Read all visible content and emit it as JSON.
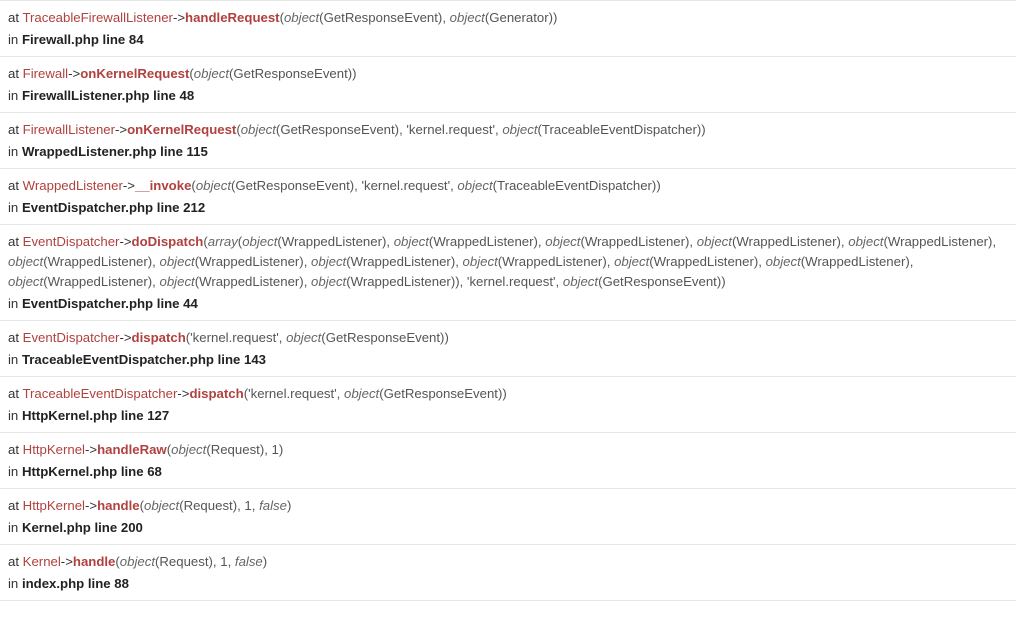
{
  "labels": {
    "at": "at",
    "in": "in",
    "arrow": "->"
  },
  "frames": [
    {
      "class": "TraceableFirewallListener",
      "function": "handleRequest",
      "args": [
        {
          "t": "p",
          "v": "("
        },
        {
          "t": "k",
          "v": "object"
        },
        {
          "t": "p",
          "v": "(GetResponseEvent), "
        },
        {
          "t": "k",
          "v": "object"
        },
        {
          "t": "p",
          "v": "(Generator))"
        }
      ],
      "location": "Firewall.php line 84"
    },
    {
      "class": "Firewall",
      "function": "onKernelRequest",
      "args": [
        {
          "t": "p",
          "v": "("
        },
        {
          "t": "k",
          "v": "object"
        },
        {
          "t": "p",
          "v": "(GetResponseEvent))"
        }
      ],
      "location": "FirewallListener.php line 48"
    },
    {
      "class": "FirewallListener",
      "function": "onKernelRequest",
      "args": [
        {
          "t": "p",
          "v": "("
        },
        {
          "t": "k",
          "v": "object"
        },
        {
          "t": "p",
          "v": "(GetResponseEvent), 'kernel.request', "
        },
        {
          "t": "k",
          "v": "object"
        },
        {
          "t": "p",
          "v": "(TraceableEventDispatcher))"
        }
      ],
      "location": "WrappedListener.php line 115"
    },
    {
      "class": "WrappedListener",
      "function": "__invoke",
      "args": [
        {
          "t": "p",
          "v": "("
        },
        {
          "t": "k",
          "v": "object"
        },
        {
          "t": "p",
          "v": "(GetResponseEvent), 'kernel.request', "
        },
        {
          "t": "k",
          "v": "object"
        },
        {
          "t": "p",
          "v": "(TraceableEventDispatcher))"
        }
      ],
      "location": "EventDispatcher.php line 212"
    },
    {
      "class": "EventDispatcher",
      "function": "doDispatch",
      "args": [
        {
          "t": "p",
          "v": "("
        },
        {
          "t": "k",
          "v": "array"
        },
        {
          "t": "p",
          "v": "("
        },
        {
          "t": "k",
          "v": "object"
        },
        {
          "t": "p",
          "v": "(WrappedListener), "
        },
        {
          "t": "k",
          "v": "object"
        },
        {
          "t": "p",
          "v": "(WrappedListener), "
        },
        {
          "t": "k",
          "v": "object"
        },
        {
          "t": "p",
          "v": "(WrappedListener), "
        },
        {
          "t": "k",
          "v": "object"
        },
        {
          "t": "p",
          "v": "(WrappedListener), "
        },
        {
          "t": "k",
          "v": "object"
        },
        {
          "t": "p",
          "v": "(WrappedListener), "
        },
        {
          "t": "k",
          "v": "object"
        },
        {
          "t": "p",
          "v": "(WrappedListener), "
        },
        {
          "t": "k",
          "v": "object"
        },
        {
          "t": "p",
          "v": "(WrappedListener), "
        },
        {
          "t": "k",
          "v": "object"
        },
        {
          "t": "p",
          "v": "(WrappedListener), "
        },
        {
          "t": "k",
          "v": "object"
        },
        {
          "t": "p",
          "v": "(WrappedListener), "
        },
        {
          "t": "k",
          "v": "object"
        },
        {
          "t": "p",
          "v": "(WrappedListener), "
        },
        {
          "t": "k",
          "v": "object"
        },
        {
          "t": "p",
          "v": "(WrappedListener), "
        },
        {
          "t": "k",
          "v": "object"
        },
        {
          "t": "p",
          "v": "(WrappedListener), "
        },
        {
          "t": "k",
          "v": "object"
        },
        {
          "t": "p",
          "v": "(WrappedListener), "
        },
        {
          "t": "k",
          "v": "object"
        },
        {
          "t": "p",
          "v": "(WrappedListener)), 'kernel.request', "
        },
        {
          "t": "k",
          "v": "object"
        },
        {
          "t": "p",
          "v": "(GetResponseEvent))"
        }
      ],
      "location": "EventDispatcher.php line 44"
    },
    {
      "class": "EventDispatcher",
      "function": "dispatch",
      "args": [
        {
          "t": "p",
          "v": "('kernel.request', "
        },
        {
          "t": "k",
          "v": "object"
        },
        {
          "t": "p",
          "v": "(GetResponseEvent))"
        }
      ],
      "location": "TraceableEventDispatcher.php line 143"
    },
    {
      "class": "TraceableEventDispatcher",
      "function": "dispatch",
      "args": [
        {
          "t": "p",
          "v": "('kernel.request', "
        },
        {
          "t": "k",
          "v": "object"
        },
        {
          "t": "p",
          "v": "(GetResponseEvent))"
        }
      ],
      "location": "HttpKernel.php line 127"
    },
    {
      "class": "HttpKernel",
      "function": "handleRaw",
      "args": [
        {
          "t": "p",
          "v": "("
        },
        {
          "t": "k",
          "v": "object"
        },
        {
          "t": "p",
          "v": "(Request), 1)"
        }
      ],
      "location": "HttpKernel.php line 68"
    },
    {
      "class": "HttpKernel",
      "function": "handle",
      "args": [
        {
          "t": "p",
          "v": "("
        },
        {
          "t": "k",
          "v": "object"
        },
        {
          "t": "p",
          "v": "(Request), 1, "
        },
        {
          "t": "k",
          "v": "false"
        },
        {
          "t": "p",
          "v": ")"
        }
      ],
      "location": "Kernel.php line 200"
    },
    {
      "class": "Kernel",
      "function": "handle",
      "args": [
        {
          "t": "p",
          "v": "("
        },
        {
          "t": "k",
          "v": "object"
        },
        {
          "t": "p",
          "v": "(Request), 1, "
        },
        {
          "t": "k",
          "v": "false"
        },
        {
          "t": "p",
          "v": ")"
        }
      ],
      "location": "index.php line 88"
    }
  ],
  "colors": {
    "class": "#b0413e",
    "function": "#b0413e",
    "divider": "#e6e6e6"
  }
}
